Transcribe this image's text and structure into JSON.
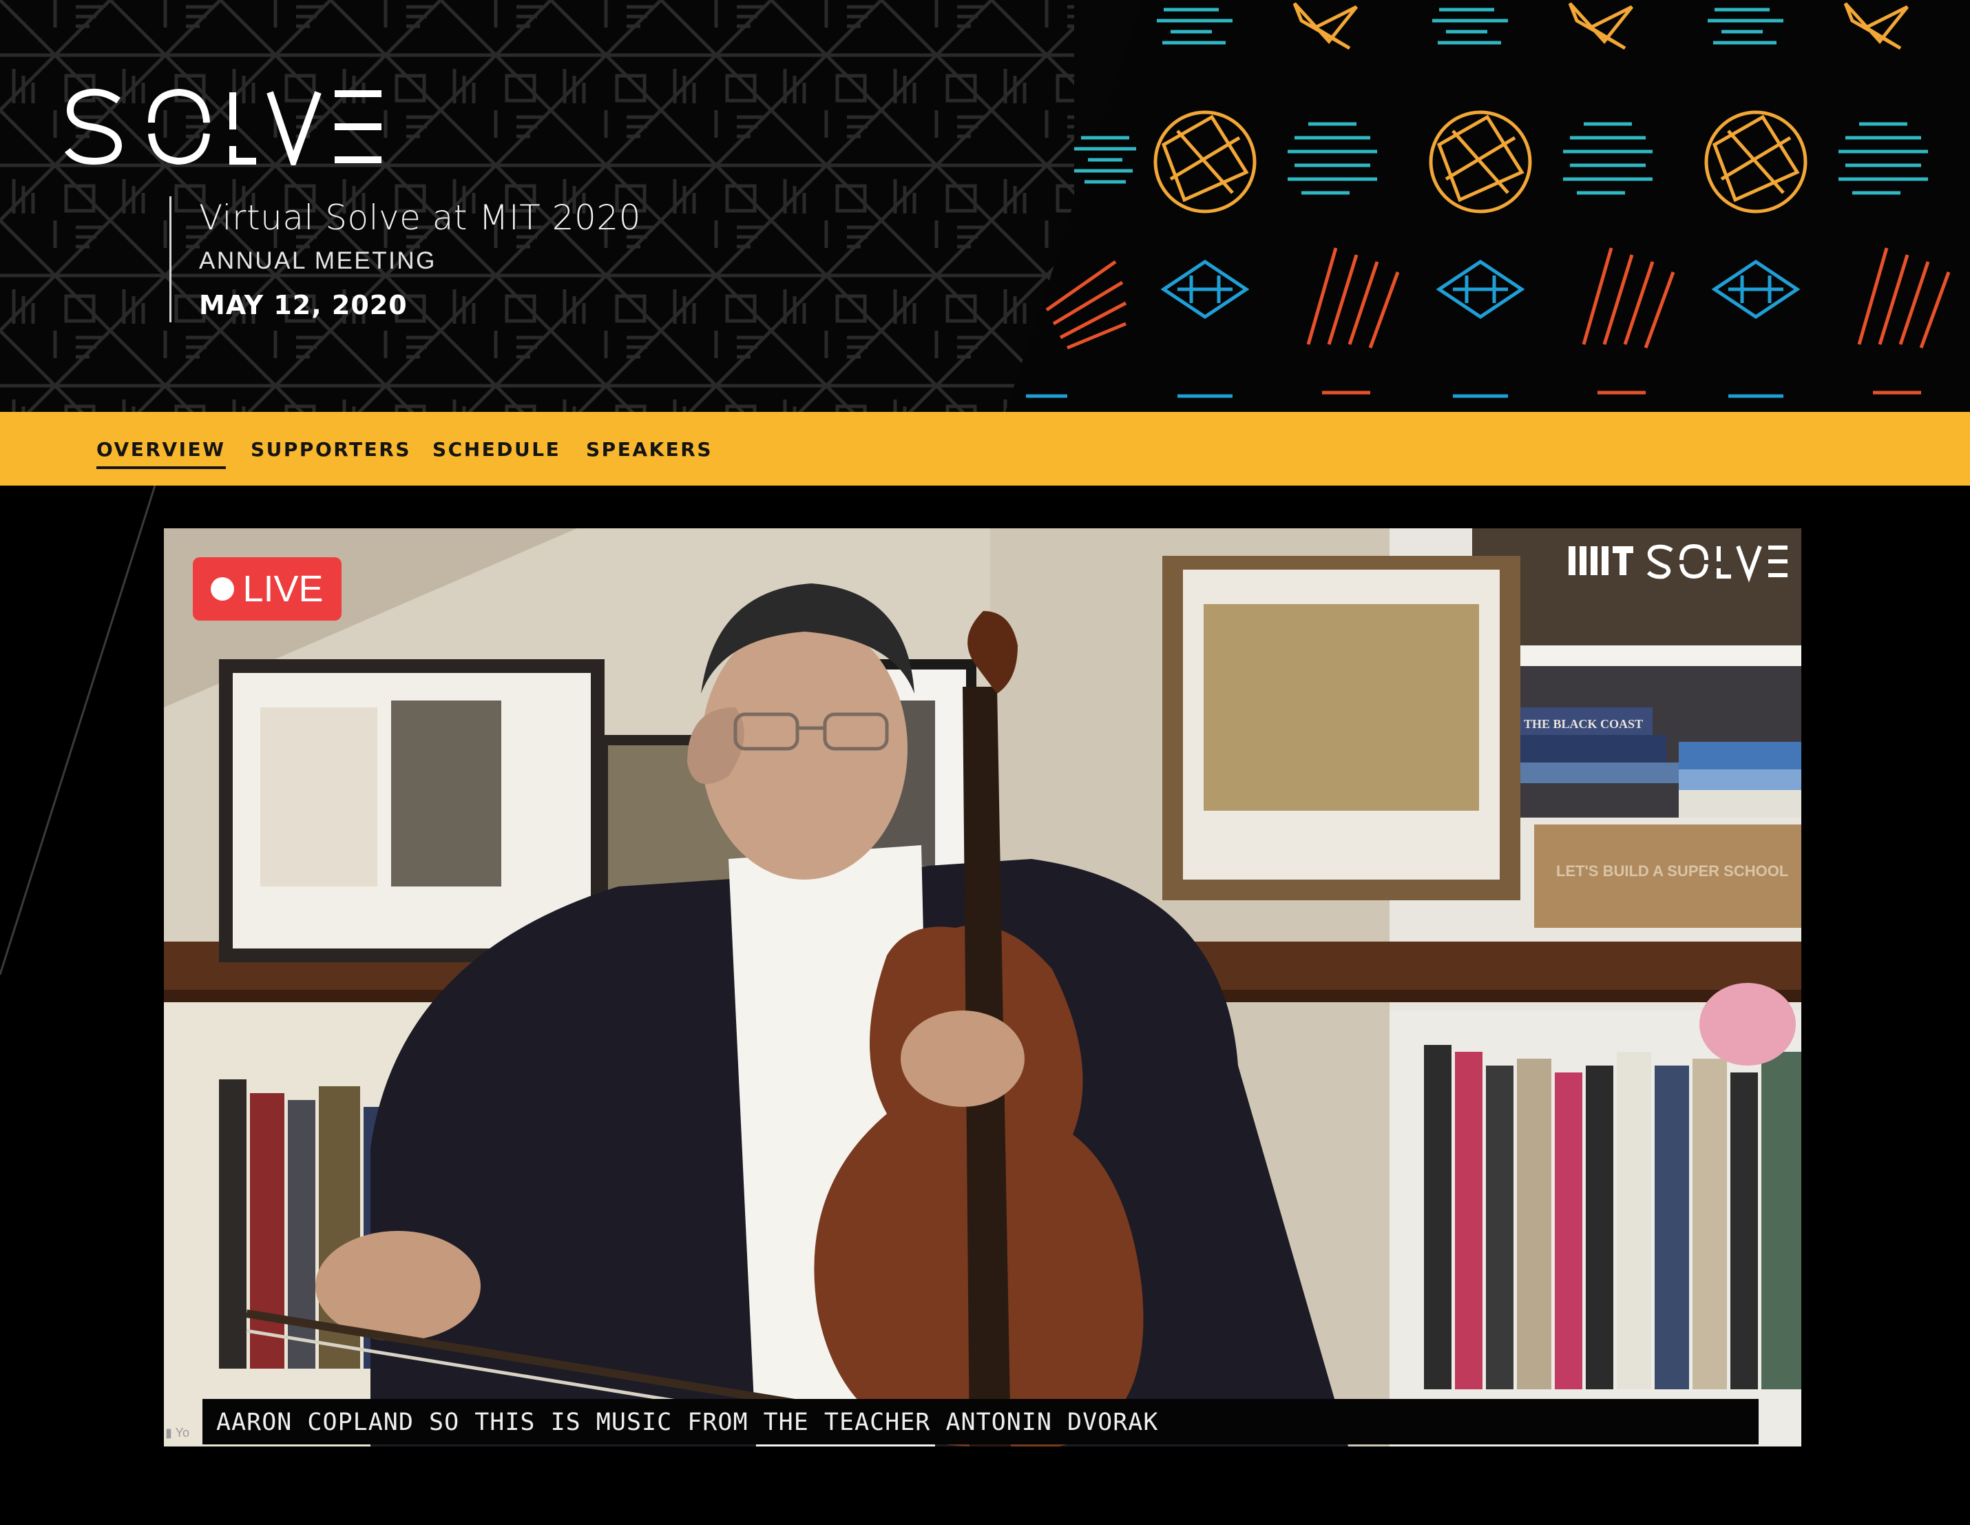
{
  "header": {
    "logo_text": "SOLVE",
    "event_title": "Virtual Solve at MIT 2020",
    "event_subtitle": "ANNUAL MEETING",
    "event_date": "MAY 12, 2020"
  },
  "nav": {
    "items": [
      {
        "label": "OVERVIEW",
        "active": true
      },
      {
        "label": "SUPPORTERS",
        "active": false
      },
      {
        "label": "SCHEDULE",
        "active": false
      },
      {
        "label": "SPEAKERS",
        "active": false
      }
    ]
  },
  "video": {
    "live_label": "LIVE",
    "watermark_text": "MIT SOLVE",
    "caption": "AARON COPLAND SO THIS IS MUSIC FROM THE TEACHER ANTONIN DVORAK",
    "source_mark": "Yo",
    "box_label": "LET'S BUILD A SUPER SCHOOL",
    "book_label": "THE BLACK COAST"
  },
  "colors": {
    "brand_yellow": "#f9b72e",
    "art_gold": "#f2a736",
    "art_teal": "#2fb7c2",
    "art_orange": "#e8522a",
    "art_blue": "#1f9fd6",
    "live_red": "#ee3d3e"
  },
  "icons": {
    "live": "live-dot-icon",
    "logo": "solve-logo-icon"
  }
}
